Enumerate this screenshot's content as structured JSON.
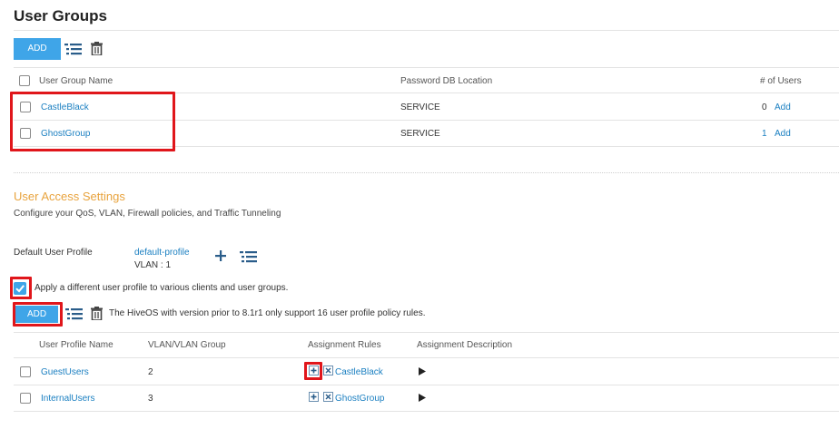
{
  "user_groups": {
    "title": "User Groups",
    "add_label": "ADD",
    "columns": [
      "User Group Name",
      "Password DB Location",
      "# of Users"
    ],
    "rows": [
      {
        "name": "CastleBlack",
        "location": "SERVICE",
        "count": "0",
        "action": "Add"
      },
      {
        "name": "GhostGroup",
        "location": "SERVICE",
        "count": "1",
        "action": "Add"
      }
    ]
  },
  "access": {
    "title": "User Access Settings",
    "subtitle": "Configure your QoS, VLAN, Firewall policies, and Traffic Tunneling",
    "default_profile_label": "Default User Profile",
    "default_profile_value": "default-profile",
    "default_profile_vlan": "VLAN : 1",
    "apply_label": "Apply a different user profile to various clients and user groups.",
    "apply_checked": true,
    "add_label": "ADD",
    "notice": "The HiveOS with version prior to 8.1r1 only support 16 user profile policy rules.",
    "columns": [
      "User Profile Name",
      "VLAN/VLAN Group",
      "Assignment Rules",
      "Assignment Description"
    ],
    "rows": [
      {
        "name": "GuestUsers",
        "vlan": "2",
        "rule": "CastleBlack"
      },
      {
        "name": "InternalUsers",
        "vlan": "3",
        "rule": "GhostGroup"
      }
    ]
  },
  "colors": {
    "accent": "#3fa5e8",
    "link": "#1a7fc1",
    "highlight": "#e0161b",
    "section_title": "#e8a33d"
  },
  "icons": [
    "list-icon",
    "trash-icon",
    "plus-icon",
    "play-icon",
    "add-rule-icon",
    "remove-rule-icon"
  ]
}
